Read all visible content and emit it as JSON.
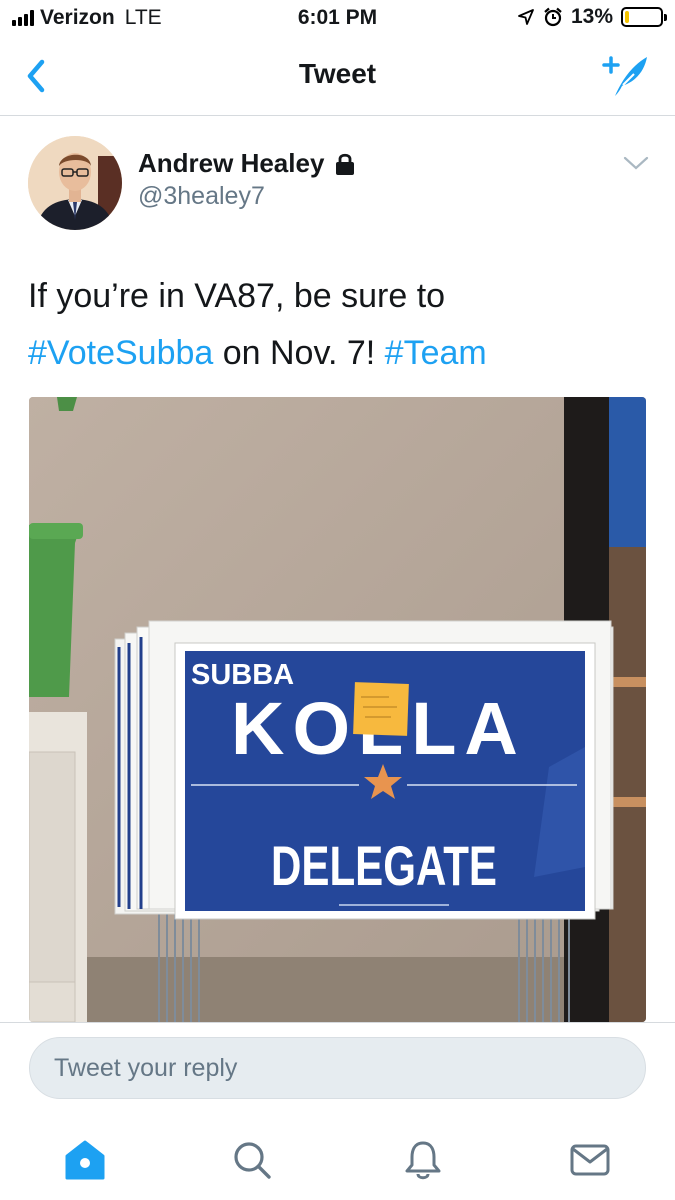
{
  "status_bar": {
    "carrier": "Verizon",
    "network": "LTE",
    "time": "6:01 PM",
    "battery_percent": "13%",
    "battery_level": 0.13,
    "icons": [
      "signal-icon",
      "location-arrow-icon",
      "alarm-icon",
      "battery-icon"
    ]
  },
  "nav": {
    "title": "Tweet",
    "back_icon": "chevron-left-icon",
    "compose_icon": "compose-tweet-icon"
  },
  "tweet": {
    "author_name": "Andrew Healey",
    "author_handle": "@3healey7",
    "protected_icon": "lock-icon",
    "menu_icon": "chevron-down-icon",
    "text_part1": "If you’re in VA87, be sure to",
    "hashtag1": "#VoteSubba",
    "text_part2": " on Nov. 7! ",
    "hashtag2": "#Team",
    "media": {
      "sign_top": "SUBBA",
      "sign_main": "KOLLA",
      "sign_bottom": "DELEGATE"
    }
  },
  "reply": {
    "placeholder": "Tweet your reply"
  },
  "tab_bar": {
    "tabs": [
      "home-icon",
      "search-icon",
      "notifications-icon",
      "messages-icon"
    ]
  },
  "colors": {
    "accent": "#1da1f2",
    "text": "#14171a",
    "secondary_text": "#657786",
    "sign_blue": "#25479a",
    "sign_star": "#e8944f",
    "battery_fill": "#f5c400"
  }
}
